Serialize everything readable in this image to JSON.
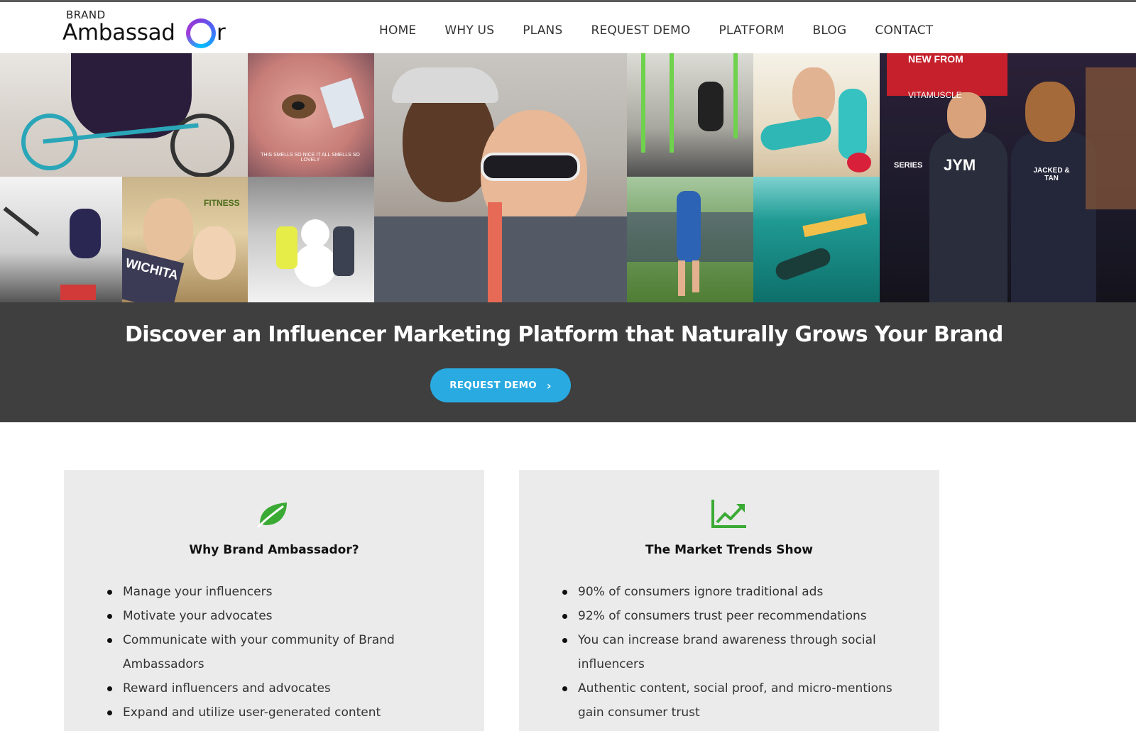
{
  "logo": {
    "brand": "BRAND",
    "word_main": "Ambassad",
    "word_end": "r"
  },
  "nav": {
    "items": [
      {
        "label": "HOME"
      },
      {
        "label": "WHY US"
      },
      {
        "label": "PLANS"
      },
      {
        "label": "REQUEST DEMO"
      },
      {
        "label": "PLATFORM"
      },
      {
        "label": "BLOG"
      },
      {
        "label": "CONTACT"
      }
    ]
  },
  "mosaic": {
    "captions": {
      "snapchat": "THIS SMELLS SO NICE IT ALL SMELLS SO LOVELY",
      "banner": "NEW FROM",
      "vitamuscle": "VITAMUSCLE",
      "series": "SERIES",
      "jym": "JYM",
      "jacked": "JACKED & TAN",
      "wichita": "WICHITA",
      "fitness": "FITNESS"
    }
  },
  "hero": {
    "headline": "Discover an Influencer Marketing Platform that Naturally Grows Your Brand",
    "cta_label": "REQUEST DEMO",
    "cta_icon": "chevron-right-icon"
  },
  "cards": {
    "why": {
      "icon": "leaf-icon",
      "title": "Why Brand Ambassador?",
      "items": [
        "Manage your influencers",
        "Motivate your advocates",
        "Communicate with your community of Brand",
        "Ambassadors",
        "Reward influencers and advocates",
        "Expand and utilize user-generated content"
      ]
    },
    "trends": {
      "icon": "trend-chart-icon",
      "title": "The Market Trends Show",
      "items": [
        "90% of consumers ignore traditional ads",
        "92% of consumers trust peer recommendations",
        "You can increase brand awareness through social",
        "influencers",
        "Authentic content, social proof, and micro-mentions",
        "gain consumer trust"
      ]
    }
  },
  "colors": {
    "accent": "#29abe2",
    "band": "#3f3f3f",
    "card": "#ebebeb",
    "icon_green": "#3aaa35"
  }
}
